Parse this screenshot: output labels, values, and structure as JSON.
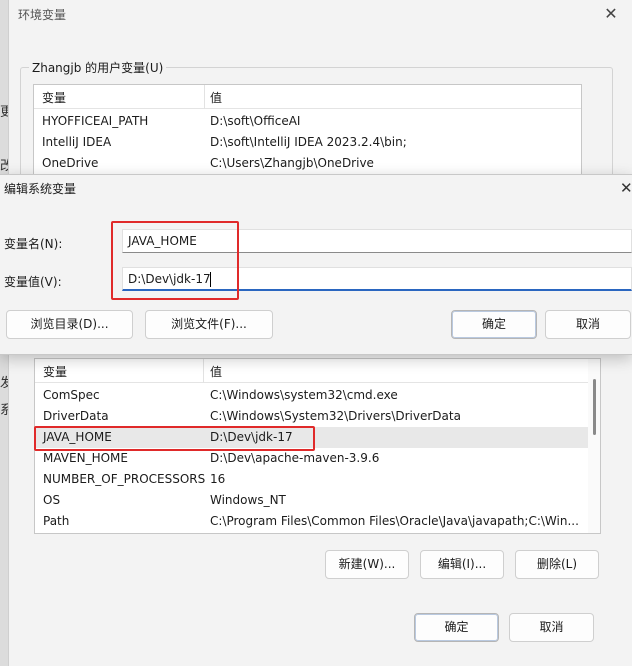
{
  "env_dialog": {
    "title": "环境变量",
    "close_glyph": "✕"
  },
  "background_chars": [
    "更",
    "改",
    "发",
    "系"
  ],
  "user_vars": {
    "legend": "Zhangjb 的用户变量(U)",
    "col_name": "变量",
    "col_value": "值",
    "rows": [
      {
        "name": "HYOFFICEAI_PATH",
        "value": "D:\\soft\\OfficeAI"
      },
      {
        "name": "IntelliJ IDEA",
        "value": "D:\\soft\\IntelliJ IDEA 2023.2.4\\bin;"
      },
      {
        "name": "OneDrive",
        "value": "C:\\Users\\Zhangjb\\OneDrive"
      }
    ]
  },
  "edit_dialog": {
    "title": "编辑系统变量",
    "close_glyph": "✕",
    "name_label": "变量名(N):",
    "name_value": "JAVA_HOME",
    "value_label": "变量值(V):",
    "value_value": "D:\\Dev\\jdk-17",
    "browse_dir": "浏览目录(D)...",
    "browse_file": "浏览文件(F)...",
    "ok": "确定",
    "cancel": "取消"
  },
  "system_vars": {
    "col_name": "变量",
    "col_value": "值",
    "rows": [
      {
        "name": "ComSpec",
        "value": "C:\\Windows\\system32\\cmd.exe"
      },
      {
        "name": "DriverData",
        "value": "C:\\Windows\\System32\\Drivers\\DriverData"
      },
      {
        "name": "JAVA_HOME",
        "value": "D:\\Dev\\jdk-17"
      },
      {
        "name": "MAVEN_HOME",
        "value": "D:\\Dev\\apache-maven-3.9.6"
      },
      {
        "name": "NUMBER_OF_PROCESSORS",
        "value": "16"
      },
      {
        "name": "OS",
        "value": "Windows_NT"
      },
      {
        "name": "Path",
        "value": "C:\\Program Files\\Common Files\\Oracle\\Java\\javapath;C:\\Win..."
      }
    ],
    "new_button": "新建(W)...",
    "edit_button": "编辑(I)...",
    "delete_button": "删除(L)"
  },
  "footer": {
    "ok": "确定",
    "cancel": "取消"
  },
  "colors": {
    "highlight": "#e02a2a",
    "focus": "#2a66c0"
  }
}
